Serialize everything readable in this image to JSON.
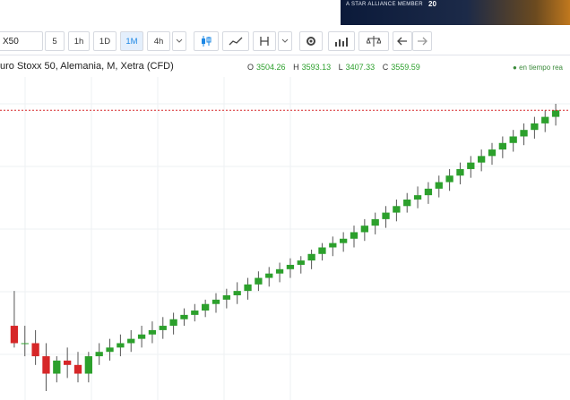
{
  "banner": {
    "text": "A STAR ALLIANCE MEMBER",
    "years": "20"
  },
  "toolbar": {
    "symbol": "X50",
    "intervals": [
      "5",
      "1h",
      "1D",
      "1M",
      "4h"
    ],
    "active_interval": "1M"
  },
  "legend": {
    "title": "uro Stoxx 50, Alemania, M, Xetra (CFD)",
    "ohlc": [
      {
        "key": "O",
        "value": "3504.26"
      },
      {
        "key": "H",
        "value": "3593.13"
      },
      {
        "key": "L",
        "value": "3407.33"
      },
      {
        "key": "C",
        "value": "3559.59"
      }
    ],
    "status": "en tiempo rea"
  },
  "colors": {
    "up": "#2ca02c",
    "down": "#d62728",
    "grid": "#eef0f3",
    "price_line": "#d62728"
  },
  "chart_data": {
    "type": "candlestick",
    "last_close": 3559.59,
    "candles": [
      [
        370,
        450,
        320,
        330
      ],
      [
        330,
        370,
        300,
        330
      ],
      [
        330,
        360,
        280,
        300
      ],
      [
        300,
        330,
        220,
        260
      ],
      [
        260,
        300,
        240,
        290
      ],
      [
        290,
        320,
        250,
        280
      ],
      [
        280,
        310,
        240,
        260
      ],
      [
        260,
        310,
        240,
        300
      ],
      [
        300,
        330,
        280,
        310
      ],
      [
        310,
        340,
        290,
        320
      ],
      [
        320,
        350,
        300,
        330
      ],
      [
        330,
        360,
        310,
        340
      ],
      [
        340,
        370,
        320,
        350
      ],
      [
        350,
        380,
        330,
        360
      ],
      [
        360,
        390,
        340,
        370
      ],
      [
        370,
        400,
        350,
        385
      ],
      [
        385,
        410,
        370,
        395
      ],
      [
        395,
        420,
        380,
        405
      ],
      [
        405,
        430,
        390,
        420
      ],
      [
        420,
        445,
        400,
        430
      ],
      [
        430,
        455,
        410,
        440
      ],
      [
        440,
        470,
        420,
        450
      ],
      [
        450,
        480,
        430,
        465
      ],
      [
        465,
        495,
        450,
        480
      ],
      [
        480,
        505,
        460,
        490
      ],
      [
        490,
        515,
        470,
        500
      ],
      [
        500,
        525,
        480,
        510
      ],
      [
        510,
        530,
        490,
        520
      ],
      [
        520,
        545,
        500,
        535
      ],
      [
        535,
        560,
        520,
        550
      ],
      [
        550,
        575,
        530,
        560
      ],
      [
        560,
        585,
        540,
        570
      ],
      [
        570,
        600,
        550,
        585
      ],
      [
        585,
        615,
        565,
        600
      ],
      [
        600,
        630,
        580,
        615
      ],
      [
        615,
        645,
        595,
        630
      ],
      [
        630,
        660,
        610,
        645
      ],
      [
        645,
        675,
        630,
        660
      ],
      [
        660,
        690,
        640,
        670
      ],
      [
        670,
        700,
        650,
        685
      ],
      [
        685,
        715,
        665,
        700
      ],
      [
        700,
        730,
        680,
        715
      ],
      [
        715,
        745,
        695,
        730
      ],
      [
        730,
        760,
        710,
        745
      ],
      [
        745,
        775,
        725,
        760
      ],
      [
        760,
        790,
        740,
        775
      ],
      [
        775,
        805,
        755,
        790
      ],
      [
        790,
        820,
        770,
        805
      ],
      [
        805,
        835,
        785,
        820
      ],
      [
        820,
        850,
        800,
        835
      ],
      [
        835,
        865,
        815,
        850
      ],
      [
        850,
        880,
        830,
        865
      ]
    ]
  }
}
